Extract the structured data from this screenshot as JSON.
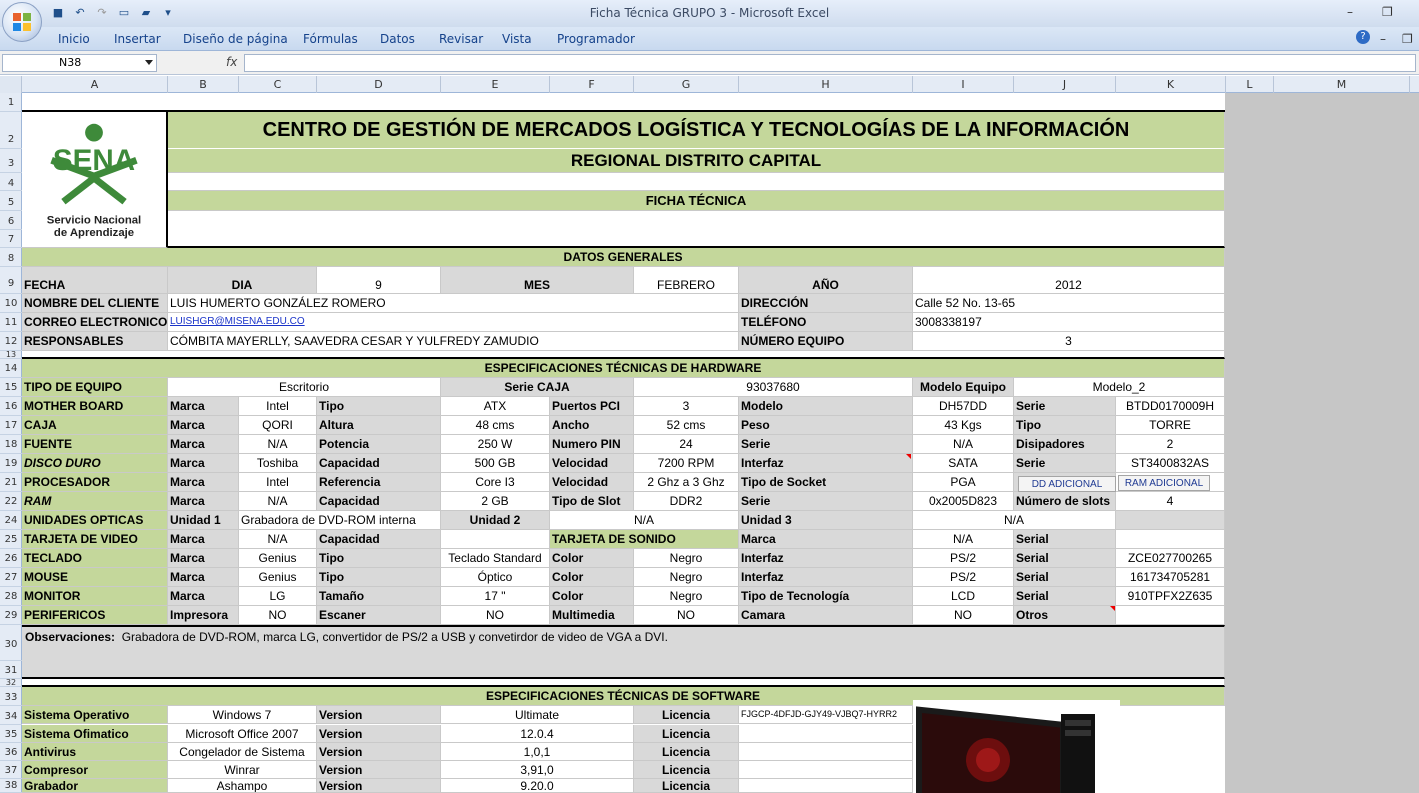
{
  "window": {
    "title": "Ficha Técnica GRUPO 3 - Microsoft Excel"
  },
  "ribbon": {
    "tabs": [
      "Inicio",
      "Insertar",
      "Diseño de página",
      "Fórmulas",
      "Datos",
      "Revisar",
      "Vista",
      "Programador"
    ]
  },
  "formula_bar": {
    "name_box": "N38",
    "fx": "fx",
    "formula": ""
  },
  "columns": [
    "A",
    "B",
    "C",
    "D",
    "E",
    "F",
    "G",
    "H",
    "I",
    "J",
    "K",
    "L",
    "M"
  ],
  "rows": [
    "1",
    "2",
    "3",
    "4",
    "5",
    "6",
    "7",
    "8",
    "9",
    "10",
    "11",
    "12",
    "13",
    "14",
    "15",
    "16",
    "17",
    "18",
    "19",
    "21",
    "22",
    "24",
    "25",
    "26",
    "27",
    "28",
    "29",
    "30",
    "31",
    "32",
    "33",
    "34",
    "35",
    "36",
    "37",
    "38"
  ],
  "logo": {
    "text": "SENA",
    "sub1": "Servicio Nacional",
    "sub2": "de Aprendizaje"
  },
  "header": {
    "title": "CENTRO DE GESTIÓN DE MERCADOS LOGÍSTICA Y TECNOLOGÍAS DE LA INFORMACIÓN",
    "subtitle": "REGIONAL DISTRITO CAPITAL",
    "ficha": "FICHA TÉCNICA"
  },
  "datos": {
    "section": "DATOS GENERALES",
    "fecha": "FECHA",
    "dia_l": "DIA",
    "dia": "9",
    "mes_l": "MES",
    "mes": "FEBRERO",
    "anio_l": "AÑO",
    "anio": "2012",
    "cliente_l": "NOMBRE DEL CLIENTE",
    "cliente": "LUIS HUMERTO GONZÁLEZ ROMERO",
    "dir_l": "DIRECCIÓN",
    "dir": "Calle 52  No. 13-65",
    "correo_l": "CORREO ELECTRONICO",
    "correo": "LUISHGR@MISENA.EDU.CO",
    "tel_l": "TELÉFONO",
    "tel": "3008338197",
    "resp_l": "RESPONSABLES",
    "resp": "CÓMBITA MAYERLLY,  SAAVEDRA  CESAR  Y YULFREDY ZAMUDIO",
    "num_l": "NÚMERO EQUIPO",
    "num": "3"
  },
  "hw": {
    "section": "ESPECIFICACIONES TÉCNICAS DE HARDWARE",
    "r15": [
      "TIPO DE EQUIPO",
      "Escritorio",
      "Serie CAJA",
      "93037680",
      "Modelo Equipo",
      "Modelo_2"
    ],
    "r16": [
      "MOTHER BOARD",
      "Marca",
      "Intel",
      "Tipo",
      "ATX",
      "Puertos PCI",
      "3",
      "Modelo",
      "DH57DD",
      "Serie",
      "BTDD0170009H"
    ],
    "r17": [
      "CAJA",
      "Marca",
      "QORI",
      "Altura",
      "48 cms",
      "Ancho",
      "52 cms",
      "Peso",
      "43 Kgs",
      "Tipo",
      "TORRE"
    ],
    "r18": [
      "FUENTE",
      "Marca",
      "N/A",
      "Potencia",
      "250 W",
      "Numero PIN",
      "24",
      "Serie",
      "N/A",
      "Disipadores",
      "2"
    ],
    "r19": [
      "DISCO DURO",
      "Marca",
      "Toshiba",
      "Capacidad",
      "500 GB",
      "Velocidad",
      "7200 RPM",
      "Interfaz",
      "SATA",
      "Serie",
      "ST3400832AS"
    ],
    "r21": [
      "PROCESADOR",
      "Marca",
      "Intel",
      "Referencia",
      "Core I3",
      "Velocidad",
      "2 Ghz a 3 Ghz",
      "Tipo de Socket",
      "PGA"
    ],
    "r22": [
      "RAM",
      "Marca",
      "N/A",
      "Capacidad",
      "2 GB",
      "Tipo de Slot",
      "DDR2",
      "Serie",
      "0x2005D823",
      "Número de slots",
      "4"
    ],
    "r24": [
      "UNIDADES OPTICAS",
      "Unidad 1",
      "Grabadora de DVD-ROM interna",
      "Unidad 2",
      "N/A",
      "Unidad 3",
      "N/A"
    ],
    "r25": [
      "TARJETA DE VIDEO",
      "Marca",
      "N/A",
      "Capacidad",
      "TARJETA DE SONIDO",
      "Marca",
      "N/A",
      "Serial"
    ],
    "r26": [
      "TECLADO",
      "Marca",
      "Genius",
      "Tipo",
      "Teclado Standard",
      "Color",
      "Negro",
      "Interfaz",
      "PS/2",
      "Serial",
      "ZCE027700265"
    ],
    "r27": [
      "MOUSE",
      "Marca",
      "Genius",
      "Tipo",
      "Óptico",
      "Color",
      "Negro",
      "Interfaz",
      "PS/2",
      "Serial",
      "161734705281"
    ],
    "r28": [
      "MONITOR",
      "Marca",
      "LG",
      "Tamaño",
      "17 \"",
      "Color",
      "Negro",
      "Tipo de Tecnología",
      "LCD",
      "Serial",
      "910TPFX2Z635"
    ],
    "r29": [
      "PERIFERICOS",
      "Impresora",
      "NO",
      "Escaner",
      "NO",
      "Multimedia",
      "NO",
      "Camara",
      "NO",
      "Otros"
    ],
    "btn_dd": "DD ADICIONAL",
    "btn_ram": "RAM ADICIONAL",
    "obs_l": "Observaciones:",
    "obs": "Grabadora de DVD-ROM, marca LG, convertidor de PS/2 a USB y convetirdor de video de VGA a DVI."
  },
  "sw": {
    "section": "ESPECIFICACIONES TÉCNICAS DE SOFTWARE",
    "rows": [
      [
        "Sistema Operativo",
        "Windows 7",
        "Version",
        "Ultimate",
        "Licencia",
        "FJGCP-4DFJD-GJY49-VJBQ7-HYRR2"
      ],
      [
        "Sistema Ofimatico",
        "Microsoft Office 2007",
        "Version",
        "12.0.4",
        "Licencia",
        ""
      ],
      [
        "Antivirus",
        "Congelador de Sistema",
        "Version",
        "1,0,1",
        "Licencia",
        ""
      ],
      [
        "Compresor",
        "Winrar",
        "Version",
        "3,91,0",
        "Licencia",
        ""
      ],
      [
        "Grabador",
        "Ashampo",
        "Version",
        "9.20.0",
        "Licencia",
        ""
      ]
    ]
  }
}
